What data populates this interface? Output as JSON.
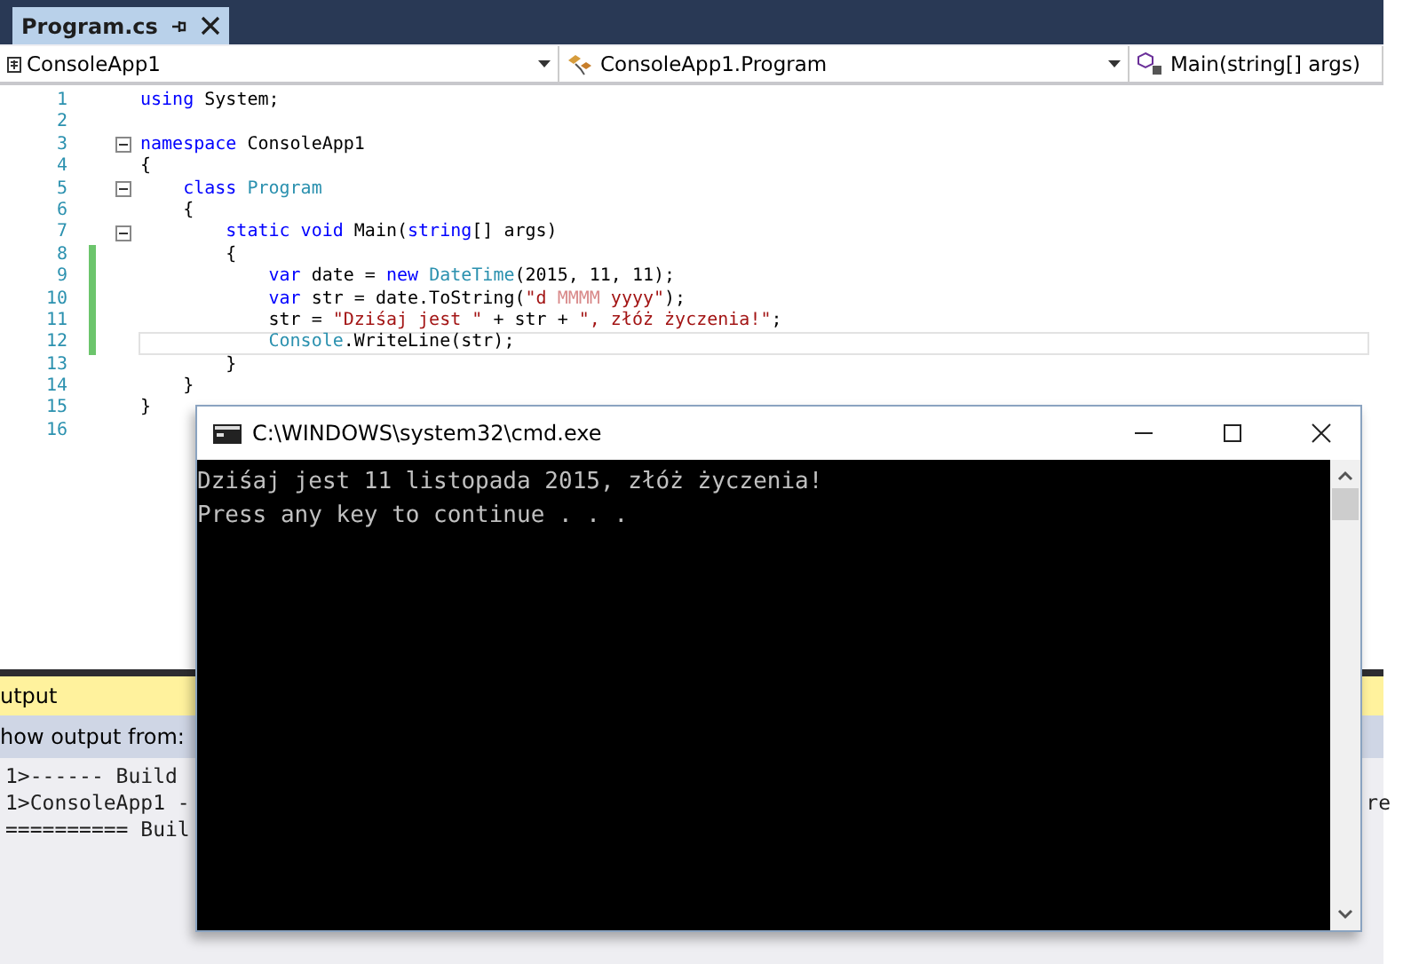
{
  "editor_tab": {
    "label": "Program.cs",
    "selected": true
  },
  "nav_bar": [
    {
      "kind": "project",
      "label": "ConsoleApp1"
    },
    {
      "kind": "class",
      "label": "ConsoleApp1.Program"
    },
    {
      "kind": "method",
      "label": "Main(string[] args)"
    }
  ],
  "code_lines": [
    {
      "number": "1",
      "fold": false,
      "changed": false,
      "current": false,
      "tokens": [
        {
          "kind": "keyword",
          "text": "using"
        },
        {
          "kind": "plain",
          "text": " System;"
        }
      ]
    },
    {
      "number": "2",
      "fold": false,
      "changed": false,
      "current": false
    },
    {
      "number": "3",
      "fold": true,
      "changed": false,
      "current": false,
      "tokens": [
        {
          "kind": "keyword",
          "text": "namespace"
        },
        {
          "kind": "plain",
          "text": " ConsoleApp1"
        }
      ]
    },
    {
      "number": "4",
      "fold": false,
      "changed": false,
      "current": false,
      "tokens": [
        {
          "kind": "plain",
          "text": "{"
        }
      ]
    },
    {
      "number": "5",
      "fold": true,
      "changed": false,
      "current": false,
      "tokens": [
        {
          "kind": "keyword",
          "text": "    class"
        },
        {
          "kind": "type",
          "text": " Program"
        }
      ]
    },
    {
      "number": "6",
      "fold": false,
      "changed": false,
      "current": false,
      "tokens": [
        {
          "kind": "plain",
          "text": "    {"
        }
      ]
    },
    {
      "number": "7",
      "fold": true,
      "changed": false,
      "current": false,
      "tokens": [
        {
          "kind": "keyword",
          "text": "        static void"
        },
        {
          "kind": "plain",
          "text": " Main("
        },
        {
          "kind": "keyword",
          "text": "string"
        },
        {
          "kind": "plain",
          "text": "[] args)"
        }
      ]
    },
    {
      "number": "8",
      "fold": false,
      "changed": true,
      "current": false,
      "tokens": [
        {
          "kind": "plain",
          "text": "        {"
        }
      ]
    },
    {
      "number": "9",
      "fold": false,
      "changed": true,
      "current": false,
      "tokens": [
        {
          "kind": "keyword",
          "text": "            var"
        },
        {
          "kind": "plain",
          "text": " date = "
        },
        {
          "kind": "keyword",
          "text": "new"
        },
        {
          "kind": "type",
          "text": " DateTime"
        },
        {
          "kind": "plain",
          "text": "(2015, 11, 11);"
        }
      ]
    },
    {
      "number": "10",
      "fold": false,
      "changed": true,
      "current": false,
      "tokens": [
        {
          "kind": "keyword",
          "text": "            var"
        },
        {
          "kind": "plain",
          "text": " str = date.ToString("
        },
        {
          "kind": "string",
          "text": "\"d "
        },
        {
          "kind": "format",
          "text": "MMMM"
        },
        {
          "kind": "string",
          "text": " yyyy\""
        },
        {
          "kind": "plain",
          "text": ");"
        }
      ]
    },
    {
      "number": "11",
      "fold": false,
      "changed": true,
      "current": false,
      "tokens": [
        {
          "kind": "plain",
          "text": "            str = "
        },
        {
          "kind": "string",
          "text": "\"Dziśaj jest \""
        },
        {
          "kind": "plain",
          "text": " + str + "
        },
        {
          "kind": "string",
          "text": "\", złóż życzenia!\""
        },
        {
          "kind": "plain",
          "text": ";"
        }
      ]
    },
    {
      "number": "12",
      "fold": false,
      "changed": true,
      "current": true,
      "tokens": [
        {
          "kind": "type",
          "text": "            Console"
        },
        {
          "kind": "plain",
          "text": ".WriteLine(str);"
        }
      ]
    },
    {
      "number": "13",
      "fold": false,
      "changed": false,
      "current": false,
      "tokens": [
        {
          "kind": "plain",
          "text": "        }"
        }
      ]
    },
    {
      "number": "14",
      "fold": false,
      "changed": false,
      "current": false,
      "tokens": [
        {
          "kind": "plain",
          "text": "    }"
        }
      ]
    },
    {
      "number": "15",
      "fold": false,
      "changed": false,
      "current": false,
      "tokens": [
        {
          "kind": "plain",
          "text": "}"
        }
      ]
    },
    {
      "number": "16",
      "fold": false,
      "changed": false,
      "current": false
    }
  ],
  "output_panel": {
    "title": "utput",
    "source_label": "how output from:",
    "lines": [
      {
        "text": "1>------ Build"
      },
      {
        "text": "1>ConsoleApp1 -",
        "tail": "re"
      },
      {
        "text": "========== Buil"
      }
    ]
  },
  "console_window": {
    "title": "C:\\WINDOWS\\system32\\cmd.exe",
    "lines": [
      "Dziśaj jest 11 listopada 2015, złóż życzenia!",
      "Press any key to continue . . ."
    ]
  }
}
